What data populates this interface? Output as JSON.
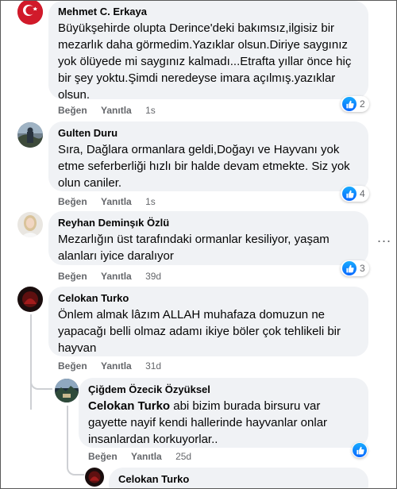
{
  "comments": [
    {
      "author": "Mehmet C. Erkaya",
      "text": "Büyükşehirde olupta Derince'deki bakımsız,ilgisiz bir mezarlık daha görmedim.Yazıklar olsun.Diriye saygınız yok ölüyede mi saygınız kalmadı...Etrafta yıllar önce hiç bir şey yoktu.Şimdi neredeyse imara açılmış.yazıklar olsun.",
      "like": "Beğen",
      "reply": "Yanıtla",
      "time": "1s",
      "reactions": "2",
      "avatar_icon": "turkish-flag-avatar"
    },
    {
      "author": "Gulten Duru",
      "text": "Sıra, Dağlara ormanlara geldi,Doğayı ve Hayvanı yok etme seferberliği hızlı bir halde devam etmekte. Siz yok olun caniler.",
      "like": "Beğen",
      "reply": "Yanıtla",
      "time": "1s",
      "reactions": "4",
      "avatar_icon": "outdoor-photo-avatar"
    },
    {
      "author": "Reyhan Deminşık Özlü",
      "text": "Mezarlığın üst tarafındaki ormanlar kesiliyor, yaşam alanları iyice daralıyor",
      "like": "Beğen",
      "reply": "Yanıtla",
      "time": "39d",
      "reactions": "3",
      "avatar_icon": "woman-portrait-avatar",
      "more_label": "..."
    },
    {
      "author": "Celokan Turko",
      "text": "Önlem almak lâzım ALLAH muhafaza domuzun ne yapacağı belli olmaz adamı ikiye böler çok tehlikeli bir hayvan",
      "like": "Beğen",
      "reply": "Yanıtla",
      "time": "31d",
      "avatar_icon": "dark-red-avatar"
    }
  ],
  "reply": {
    "author": "Çiğdem Özecik Özyüksel",
    "mention": "Celokan Turko",
    "text": " abi bizim burada birsuru var gayette nayif kendi hallerinde hayvanlar onlar insanlardan korkuyorlar..",
    "like": "Beğen",
    "reply": "Yanıtla",
    "time": "25d",
    "avatar_icon": "landscape-avatar"
  },
  "nested_reply": {
    "author": "Celokan Turko",
    "avatar_icon": "dark-red-avatar"
  },
  "colors": {
    "bubble": "#f0f2f5",
    "meta": "#65676b",
    "like_blue": "#0866ff"
  }
}
